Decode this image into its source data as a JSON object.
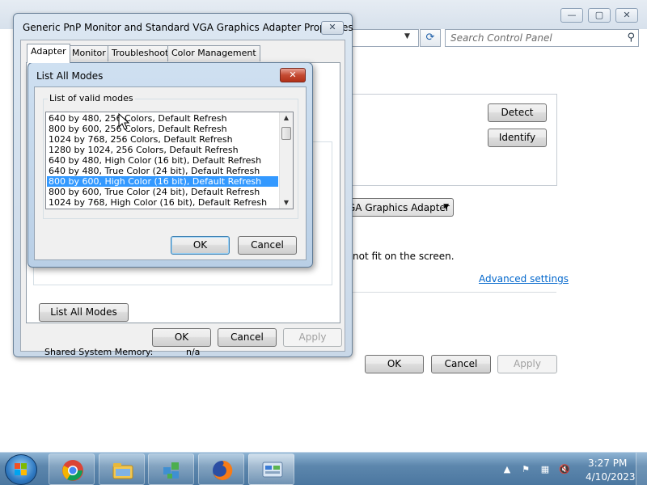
{
  "control_panel": {
    "caption_buttons": {
      "minimize": "—",
      "maximize": "▢",
      "close": "✕"
    },
    "search_placeholder": "Search Control Panel",
    "detect_button": "Detect",
    "identify_button": "Identify",
    "display_select_value": "GA Graphics Adapter",
    "fit_text": "not fit on the screen.",
    "advanced_settings_link": "Advanced settings",
    "ok_button": "OK",
    "cancel_button": "Cancel",
    "apply_button": "Apply"
  },
  "properties_dialog": {
    "title": "Generic PnP Monitor and Standard VGA Graphics Adapter Properties",
    "close_glyph": "✕",
    "tabs": [
      {
        "label": "Adapter",
        "active": true
      },
      {
        "label": "Monitor",
        "active": false
      },
      {
        "label": "Troubleshoot",
        "active": false
      },
      {
        "label": "Color Management",
        "active": false
      }
    ],
    "shared_memory_label": "Shared System Memory:",
    "shared_memory_value": "n/a",
    "list_all_modes_button": "List All Modes",
    "ok_button": "OK",
    "cancel_button": "Cancel",
    "apply_button": "Apply"
  },
  "list_modes_dialog": {
    "title": "List All Modes",
    "close_glyph": "✕",
    "group_label": "List of valid modes",
    "modes": [
      "640 by 480, 256 Colors, Default Refresh",
      "800 by 600, 256 Colors, Default Refresh",
      "1024 by 768, 256 Colors, Default Refresh",
      "1280 by 1024, 256 Colors, Default Refresh",
      "640 by 480, High Color (16 bit), Default Refresh",
      "640 by 480, True Color (24 bit), Default Refresh",
      "800 by 600, High Color (16 bit), Default Refresh",
      "800 by 600, True Color (24 bit), Default Refresh",
      "1024 by 768, High Color (16 bit), Default Refresh"
    ],
    "selected_index": 6,
    "ok_button": "OK",
    "cancel_button": "Cancel"
  },
  "taskbar": {
    "apps": [
      {
        "name": "chrome-icon"
      },
      {
        "name": "file-explorer-icon"
      },
      {
        "name": "network-app-icon"
      },
      {
        "name": "firefox-icon"
      },
      {
        "name": "control-panel-icon"
      }
    ],
    "clock_time": "3:27 PM",
    "clock_date": "4/10/2023"
  },
  "colors": {
    "selection": "#3399ff",
    "link": "#0066cc",
    "taskbar": "#4b77a0"
  }
}
